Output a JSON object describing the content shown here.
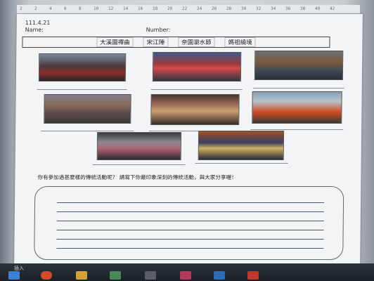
{
  "ruler": {
    "ticks": [
      "2",
      "2",
      "4",
      "6",
      "8",
      "10",
      "12",
      "14",
      "16",
      "18",
      "20",
      "22",
      "24",
      "26",
      "28",
      "30",
      "32",
      "34",
      "36",
      "38",
      "40",
      "42"
    ]
  },
  "header": {
    "date": "111.4.21",
    "name_label": "Name:",
    "number_label": "Number:"
  },
  "festivals": [
    "大溪園禪曲",
    "宋江陣",
    "奈園瀏水節",
    "媽祖繞境"
  ],
  "question": "你有參加過甚麼樣的傳統活動呢？ 請寫下你最印象深刻的傳統活動，與大家分享喔！",
  "taskbar": {
    "label": "插入"
  },
  "colors": {
    "background": "#3f4750",
    "page": "#f3f4f6"
  },
  "icons": {
    "taskbar": [
      "windows-icon",
      "browser-icon",
      "folder-icon",
      "app-icon",
      "app-icon",
      "app-icon",
      "app-icon",
      "app-icon"
    ]
  }
}
